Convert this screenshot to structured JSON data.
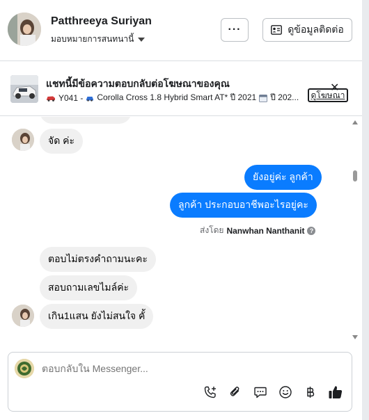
{
  "header": {
    "name": "Patthreeya Suriyan",
    "assign_label": "มอบหมายการสนทนานี้",
    "more_label": "···",
    "contact_label": "ดูข้อมูลติดต่อ"
  },
  "ad": {
    "title": "แชทนี้มีข้อความตอบกลับต่อโฆษณาของคุณ",
    "detail_code": "Y041 -",
    "detail_model": "Corolla Cross 1.8 Hybrid Smart AT* ปี 2021",
    "detail_tail": "ปี 202...",
    "link_label": "ดูโฆษณา",
    "close_label": "✕"
  },
  "messages": {
    "in_1": "จัด ค่ะ",
    "out_1": "ยังอยู่ค่ะ  ลูกค้า",
    "out_2": "ลูกค้า  ประกอบอาชีพอะไรอยู่คะ",
    "sent_by_prefix": "ส่งโดย",
    "sent_by_name": "Nanwhan Nanthanit",
    "in_2": "ตอบไม่ตรงคำถามนะคะ",
    "in_3": "สอบถามเลขไมล์ค่ะ",
    "in_4": "เกิน1แสน ยังไม่สนใจ คั้"
  },
  "composer": {
    "placeholder": "ตอบกลับใน Messenger...",
    "tools": [
      "phone-plus-icon",
      "paperclip-icon",
      "chat-bubble-icon",
      "emoji-icon",
      "baht-icon",
      "thumbs-up-icon"
    ]
  },
  "colors": {
    "outgoing_bubble": "#0a7cff",
    "incoming_bubble": "#f0f0f0",
    "thumbs_up": "#1c1e21"
  }
}
